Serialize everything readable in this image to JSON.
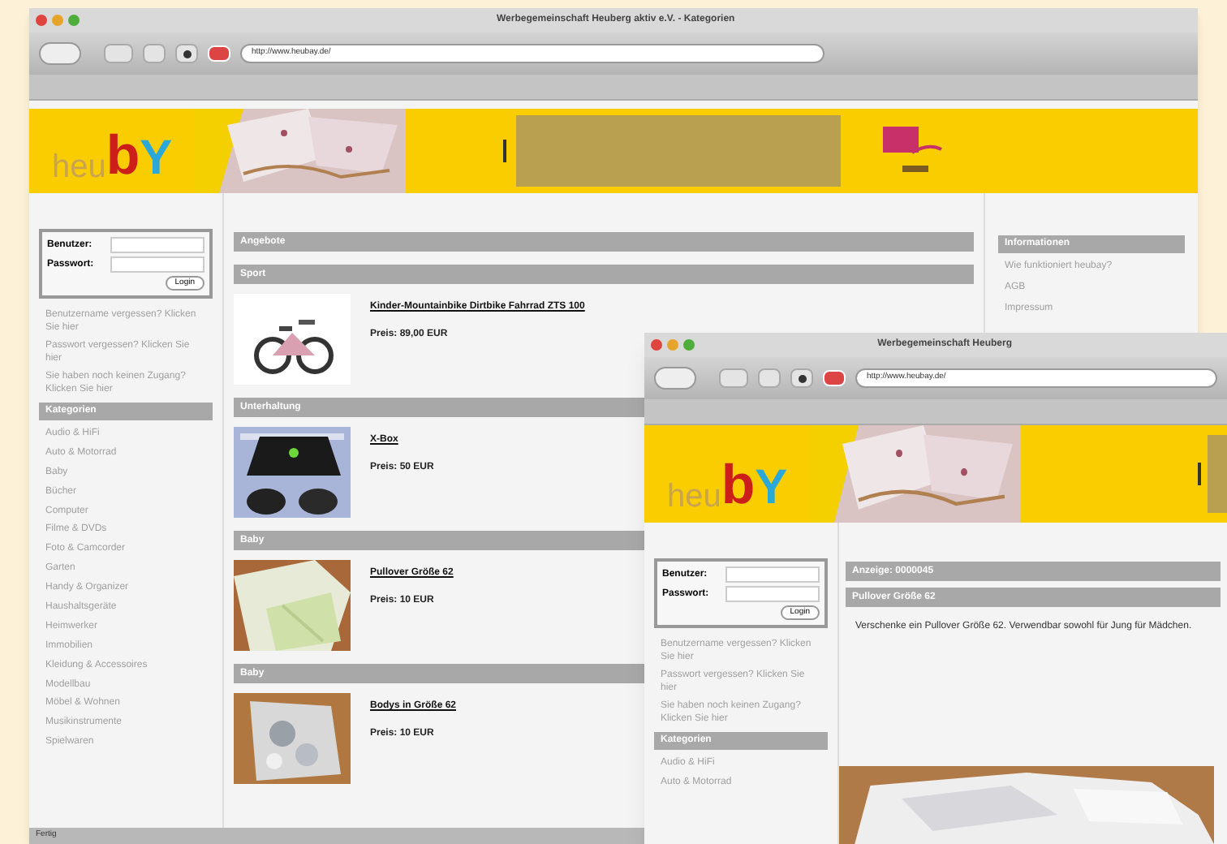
{
  "back_window": {
    "title": "Werbegemeinschaft Heuberg aktiv e.V. - Kategorien",
    "url": "http://www.heubay.de/",
    "logo": {
      "part_1": "heu",
      "part_2": "b",
      "part_3": "Y"
    },
    "login": {
      "user_label": "Benutzer:",
      "password_label": "Passwort:",
      "button": "Login"
    },
    "help_links": [
      "Benutzername vergessen? Klicken Sie hier",
      "Passwort vergessen? Klicken Sie hier",
      "Sie haben noch keinen Zugang? Klicken Sie hier"
    ],
    "categories": {
      "heading": "Kategorien",
      "items": [
        "Audio & HiFi",
        "Auto & Motorrad",
        "Baby",
        "Bücher",
        "Computer",
        "Filme & DVDs",
        "Foto & Camcorder",
        "Garten",
        "Handy & Organizer",
        "Haushaltsgeräte",
        "Heimwerker",
        "Immobilien",
        "Kleidung & Accessoires",
        "Modellbau",
        "Möbel & Wohnen",
        "Musikinstrumente",
        "Spielwaren"
      ]
    },
    "main_heading": "Angebote",
    "sections": [
      {
        "heading": "Sport",
        "title": "Kinder-Mountainbike Dirtbike Fahrrad ZTS 100",
        "price": "Preis: 89,00 EUR"
      },
      {
        "heading": "Unterhaltung",
        "title": "X-Box",
        "price": "Preis: 50 EUR"
      },
      {
        "heading": "Baby",
        "title": "Pullover Größe 62",
        "price": "Preis: 10 EUR"
      },
      {
        "heading": "Baby",
        "title": "Bodys in Größe 62",
        "price": "Preis: 10 EUR"
      }
    ],
    "info": {
      "heading": "Informationen",
      "items": [
        "Wie funktioniert heubay?",
        "AGB",
        "Impressum"
      ]
    },
    "status": "Fertig"
  },
  "front_window": {
    "title": "Werbegemeinschaft Heuberg",
    "url": "http://www.heubay.de/",
    "logo": {
      "part_1": "heu",
      "part_2": "b",
      "part_3": "Y"
    },
    "login": {
      "user_label": "Benutzer:",
      "password_label": "Passwort:",
      "button": "Login"
    },
    "help_links": [
      "Benutzername vergessen? Klicken Sie hier",
      "Passwort vergessen? Klicken Sie hier",
      "Sie haben noch keinen Zugang? Klicken Sie hier"
    ],
    "categories": {
      "heading": "Kategorien",
      "items": [
        "Audio & HiFi",
        "Auto & Motorrad"
      ]
    },
    "ad_number": "Anzeige: 0000045",
    "ad_title": "Pullover Größe 62",
    "description": "Verschenke ein Pullover Größe 62. Verwendbar sowohl für Jung für Mädchen."
  }
}
